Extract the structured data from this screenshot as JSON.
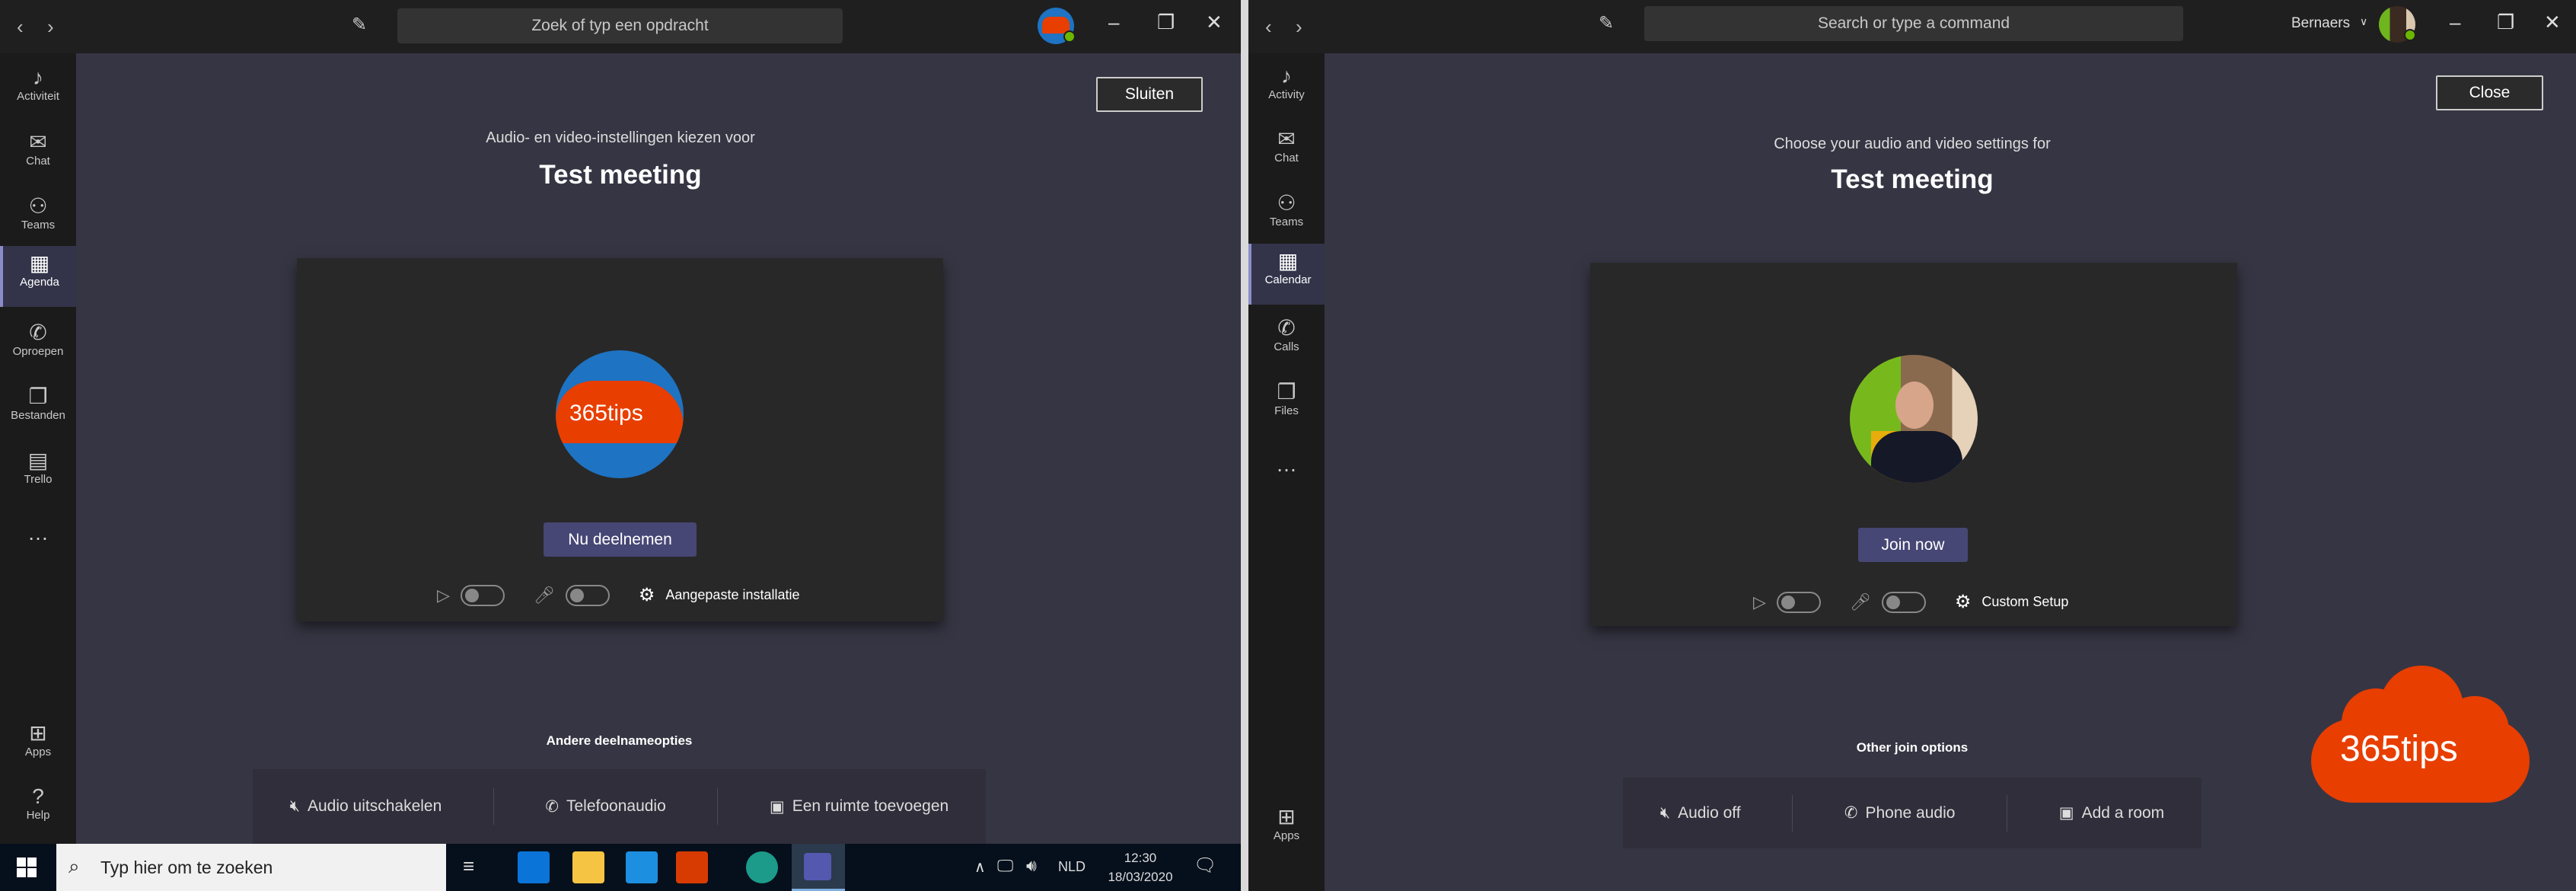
{
  "left": {
    "search_placeholder": "Zoek of typ een opdracht",
    "close_label": "Sluiten",
    "subtitle": "Audio- en video-instellingen kiezen voor",
    "meeting_title": "Test meeting",
    "join_label": "Nu deelnemen",
    "custom_setup": "Aangepaste installatie",
    "avatar_logo_text": "365tips",
    "other_options_heading": "Andere deelnameopties",
    "options": [
      "Audio uitschakelen",
      "Telefoonaudio",
      "Een ruimte toevoegen"
    ],
    "rail": [
      "Activiteit",
      "Chat",
      "Teams",
      "Agenda",
      "Oproepen",
      "Bestanden",
      "Trello"
    ],
    "rail_bottom": [
      "Apps",
      "Help"
    ],
    "selected_rail": "Agenda",
    "video_on": false,
    "mic_on": false
  },
  "right": {
    "search_placeholder": "Search or type a command",
    "user_name": "Bernaers",
    "close_label": "Close",
    "subtitle": "Choose your audio and video settings for",
    "meeting_title": "Test meeting",
    "join_label": "Join now",
    "custom_setup": "Custom Setup",
    "other_options_heading": "Other join options",
    "options": [
      "Audio off",
      "Phone audio",
      "Add a room"
    ],
    "rail": [
      "Activity",
      "Chat",
      "Teams",
      "Calendar",
      "Calls",
      "Files"
    ],
    "rail_bottom": [
      "Apps"
    ],
    "selected_rail": "Calendar",
    "video_on": false,
    "mic_on": false
  },
  "taskbar": {
    "search_placeholder": "Typ hier om te zoeken",
    "language": "NLD",
    "time": "12:30",
    "date": "18/03/2020"
  },
  "watermark": {
    "text": "365tips"
  },
  "colors": {
    "accent": "#464775",
    "brand_orange": "#e83e00",
    "content_bg": "#363543",
    "card_bg": "#282828",
    "presence": "#6bb700"
  }
}
